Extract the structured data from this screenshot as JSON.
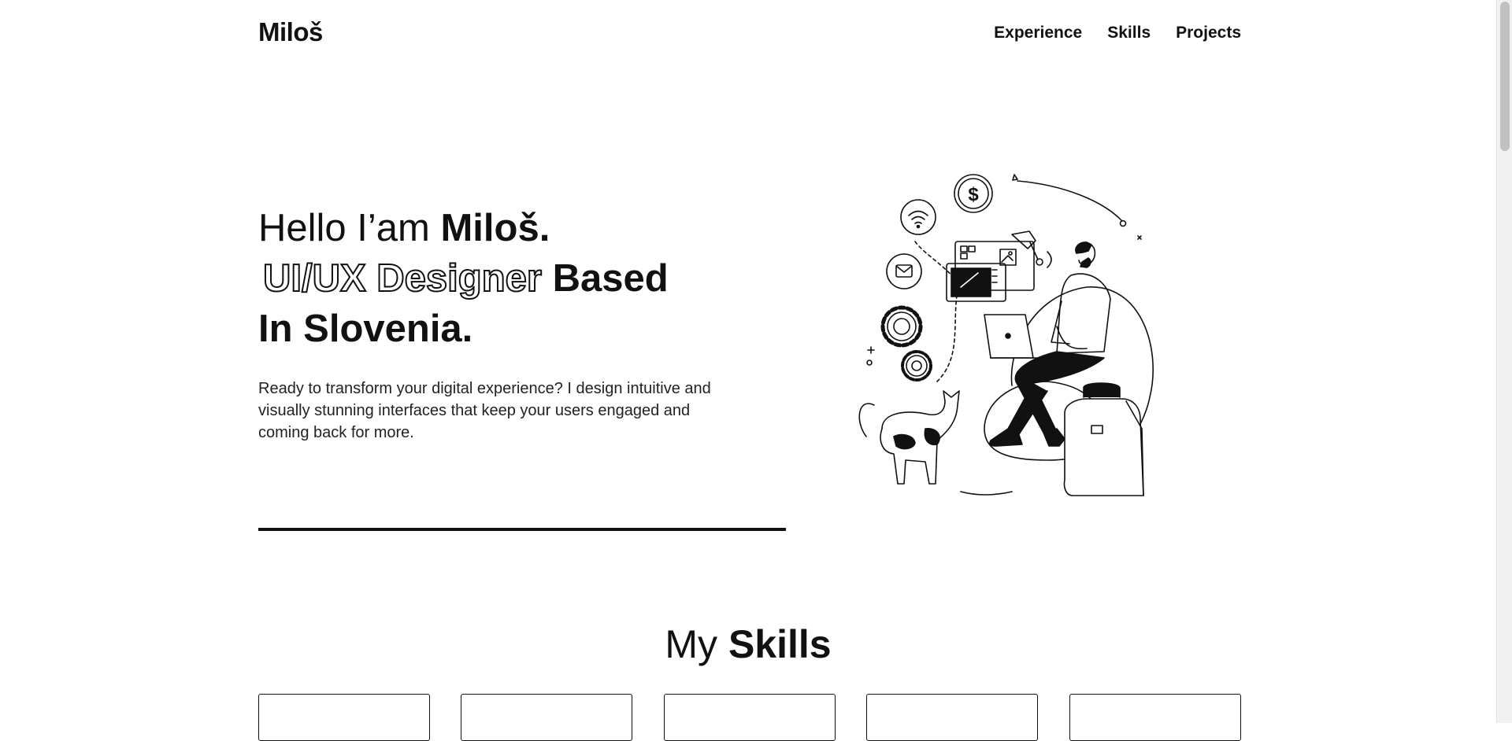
{
  "header": {
    "logo": "Miloš",
    "nav": [
      "Experience",
      "Skills",
      "Projects"
    ]
  },
  "hero": {
    "line1_light": "Hello I’am",
    "line1_bold": "Miloš.",
    "line2_outline": "UI/UX Designer",
    "line2_bold": "Based",
    "line3_bold": "In Slovenia.",
    "description": "Ready to transform your digital experience? I design intuitive and visually stunning interfaces that keep your users engaged and coming back for more."
  },
  "skills": {
    "heading_light": "My",
    "heading_bold": "Skills",
    "card_count": 5
  },
  "illustration": {
    "icon": "designer-at-laptop-illustration",
    "dollar_symbol": "$"
  }
}
